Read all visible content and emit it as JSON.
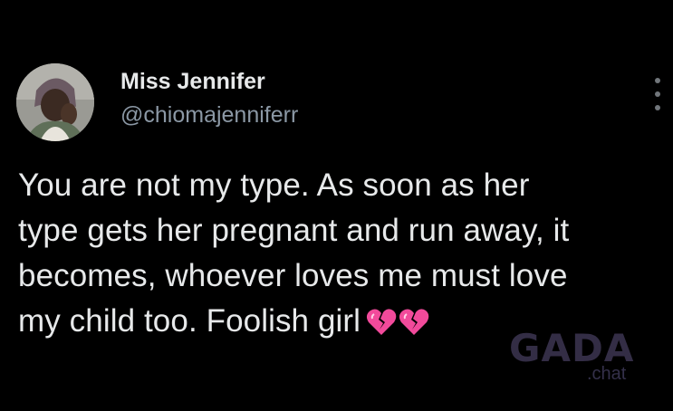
{
  "post": {
    "display_name": "Miss Jennifer",
    "handle": "@chiomajenniferr",
    "text": "You are not my type. As soon as her\ntype gets her pregnant and run away, it\nbecomes, whoever loves me must love\nmy child too. Foolish girl",
    "emojis": [
      "broken-heart",
      "broken-heart"
    ],
    "emoji_color": "#f24a9b"
  },
  "watermark": {
    "brand": "GADA",
    "sub": ".chat"
  },
  "colors": {
    "background": "#000000",
    "primary_text": "#e7e9ea",
    "secondary_text": "#8b98a5"
  }
}
